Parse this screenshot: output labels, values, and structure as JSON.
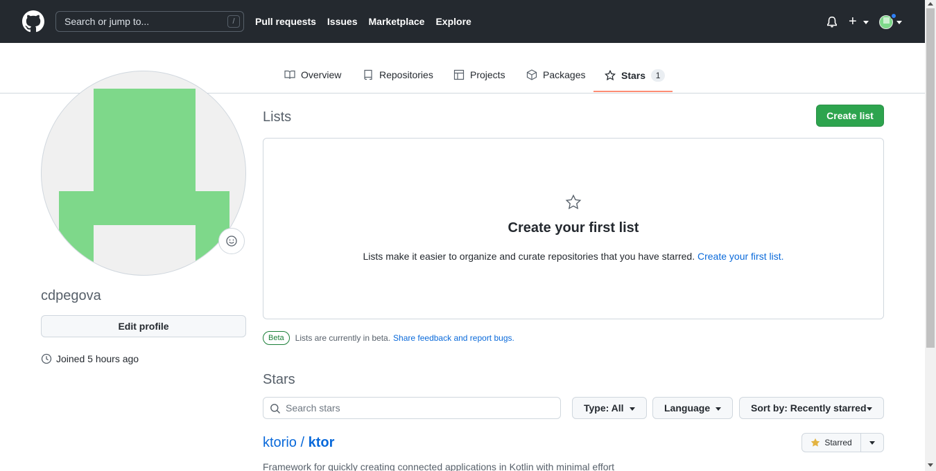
{
  "header": {
    "search_placeholder": "Search or jump to...",
    "search_shortcut": "/",
    "nav": [
      "Pull requests",
      "Issues",
      "Marketplace",
      "Explore"
    ],
    "plus": "+"
  },
  "tabs": [
    {
      "label": "Overview",
      "icon": "book-icon"
    },
    {
      "label": "Repositories",
      "icon": "repo-icon"
    },
    {
      "label": "Projects",
      "icon": "table-icon"
    },
    {
      "label": "Packages",
      "icon": "package-icon"
    },
    {
      "label": "Stars",
      "icon": "star-icon",
      "count": "1",
      "selected": true
    }
  ],
  "profile": {
    "username": "cdpegova",
    "edit_label": "Edit profile",
    "joined": "Joined 5 hours ago"
  },
  "lists": {
    "title": "Lists",
    "create_button": "Create list",
    "blank_title": "Create your first list",
    "blank_desc": "Lists make it easier to organize and curate repositories that you have starred.",
    "blank_link": "Create your first list.",
    "beta_badge": "Beta",
    "beta_text": "Lists are currently in beta.",
    "beta_link": "Share feedback and report bugs."
  },
  "stars": {
    "title": "Stars",
    "search_placeholder": "Search stars",
    "type_filter": "Type: All",
    "language_filter": "Language",
    "sort_filter": "Sort by: Recently starred",
    "repo_owner": "ktorio",
    "repo_sep": " / ",
    "repo_name": "ktor",
    "repo_desc": "Framework for quickly creating connected applications in Kotlin with minimal effort",
    "starred_label": "Starred"
  },
  "colors": {
    "header_bg": "#24292f",
    "primary_green": "#2da44e",
    "link_blue": "#0969da",
    "tab_underline": "#fd8c73",
    "avatar_green": "#7ed88a"
  }
}
